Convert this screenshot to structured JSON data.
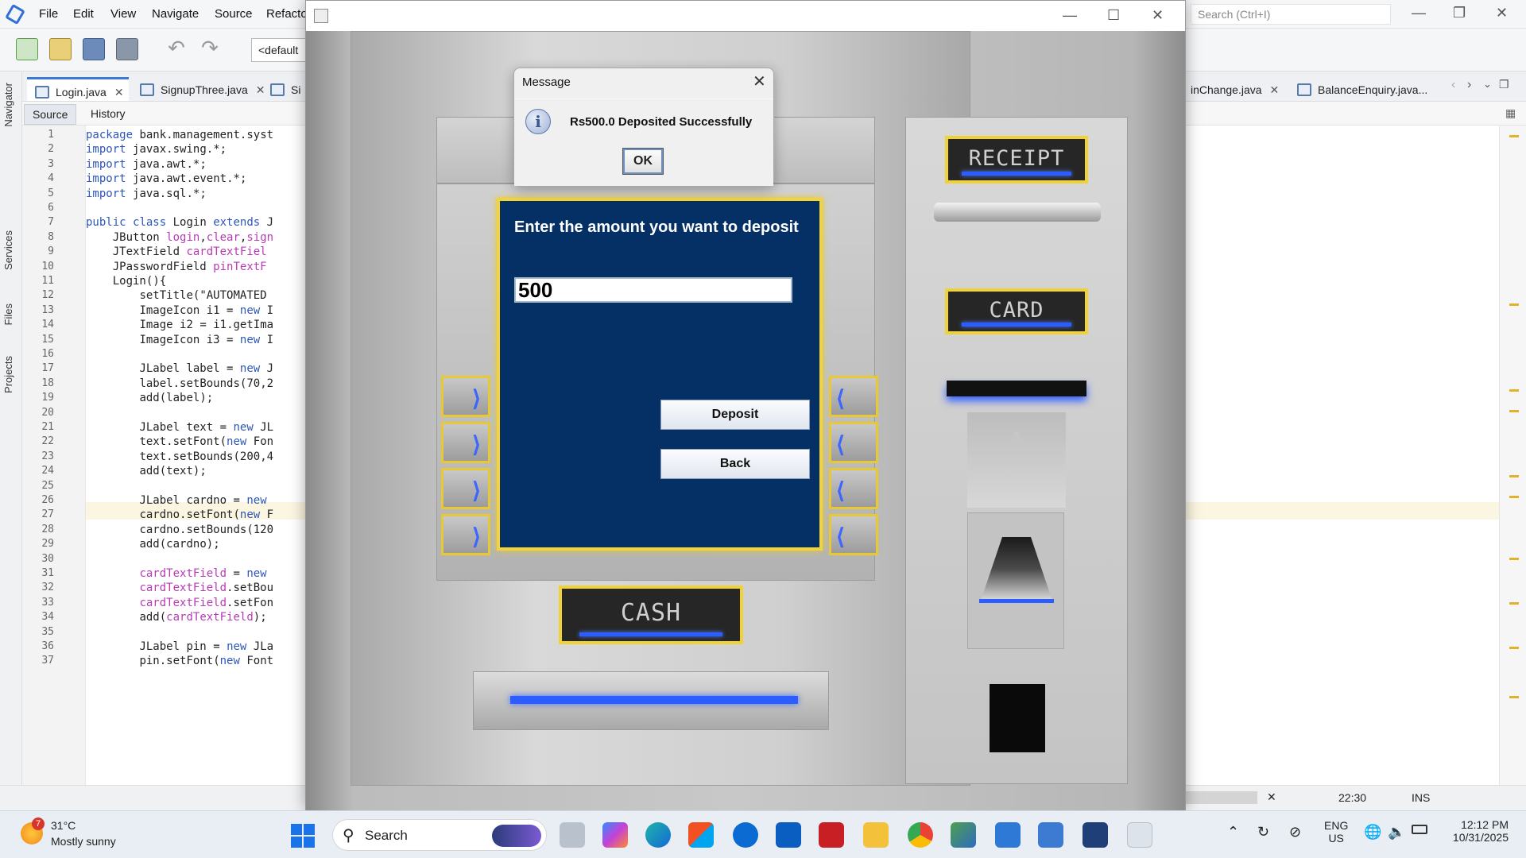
{
  "ide": {
    "menus": [
      "File",
      "Edit",
      "View",
      "Navigate",
      "Source",
      "Refacto"
    ],
    "search_placeholder": "Search (Ctrl+I)",
    "config": "<default",
    "side_tabs": [
      "Navigator",
      "Services",
      "Files",
      "Projects"
    ],
    "editor_tabs": [
      {
        "label": "Login.java"
      },
      {
        "label": "SignupThree.java"
      },
      {
        "label": "Si"
      },
      {
        "label": "inChange.java"
      },
      {
        "label": "BalanceEnquiry.java..."
      }
    ],
    "source_label": "Source",
    "history_label": "History",
    "code_lines": [
      "package bank.management.syst",
      "import javax.swing.*;",
      "import java.awt.*;",
      "import java.awt.event.*;",
      "import java.sql.*;",
      "",
      "public class Login extends J",
      "    JButton login,clear,sign",
      "    JTextField cardTextFiel",
      "    JPasswordField pinTextF",
      "    Login(){",
      "        setTitle(\"AUTOMATED ",
      "        ImageIcon i1 = new I",
      "        Image i2 = i1.getIma",
      "        ImageIcon i3 = new I",
      "",
      "        JLabel label = new J",
      "        label.setBounds(70,2",
      "        add(label);",
      "",
      "        JLabel text = new JL",
      "        text.setFont(new Fon",
      "        text.setBounds(200,4",
      "        add(text);",
      "",
      "        JLabel cardno = new ",
      "        cardno.setFont(new F",
      "        cardno.setBounds(120",
      "        add(cardno);",
      "",
      "        cardTextField = new ",
      "        cardTextField.setBou",
      "        cardTextField.setFon",
      "        add(cardTextField);",
      "",
      "        JLabel pin = new JLa",
      "        pin.setFont(new Font"
    ],
    "status": {
      "position": "22:30",
      "mode": "INS"
    }
  },
  "atm": {
    "screen_title": "Enter the amount you want to deposit",
    "amount_value": "500",
    "deposit_label": "Deposit",
    "back_label": "Back",
    "receipt_label": "RECEIPT",
    "card_label": "CARD",
    "cash_label": "CASH"
  },
  "dialog": {
    "title": "Message",
    "message": "Rs500.0 Deposited Successfully",
    "ok_label": "OK"
  },
  "taskbar": {
    "weather_temp": "31°C",
    "weather_desc": "Mostly sunny",
    "weather_badge": "7",
    "search_label": "Search",
    "lang_1": "ENG",
    "lang_2": "US",
    "time": "12:12 PM",
    "date": "10/31/2025"
  }
}
